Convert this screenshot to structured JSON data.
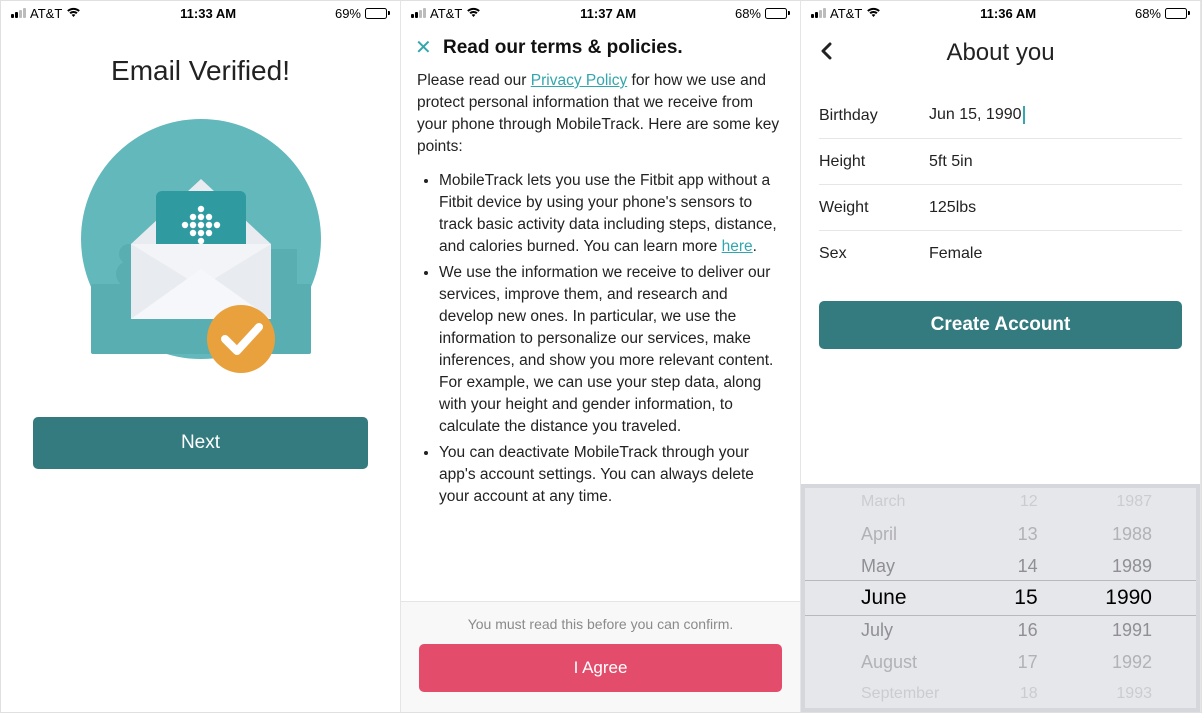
{
  "status": {
    "carrier": "AT&T",
    "screen1": {
      "time": "11:33 AM",
      "battery_pct": "69%",
      "fill": 69
    },
    "screen2": {
      "time": "11:37 AM",
      "battery_pct": "68%",
      "fill": 68
    },
    "screen3": {
      "time": "11:36 AM",
      "battery_pct": "68%",
      "fill": 68
    }
  },
  "screen1": {
    "title": "Email Verified!",
    "next_label": "Next"
  },
  "screen2": {
    "title": "Read our terms & policies.",
    "intro_pre": "Please read our ",
    "privacy_link": "Privacy Policy",
    "intro_post": " for how we use and protect personal information that we receive from your phone through MobileTrack. Here are some key points:",
    "bullet1_pre": "MobileTrack lets you use the Fitbit app without a Fitbit device by using your phone's sensors to track basic activity data including steps, distance, and calories burned. You can learn more ",
    "bullet1_link": "here",
    "bullet1_post": ".",
    "bullet2": "We use the information we receive to deliver our services, improve them, and research and develop new ones. In particular, we use the information to personalize our services, make inferences, and show you more relevant content. For example, we can use your step data, along with your height and gender information, to calculate the distance you traveled.",
    "bullet3": "You can deactivate MobileTrack through your app's account settings. You can always delete your account at any time.",
    "footer_note": "You must read this before you can confirm.",
    "agree_label": "I Agree"
  },
  "screen3": {
    "title": "About you",
    "rows": {
      "birthday_label": "Birthday",
      "birthday_value": "Jun 15, 1990",
      "height_label": "Height",
      "height_value": "5ft 5in",
      "weight_label": "Weight",
      "weight_value": "125lbs",
      "sex_label": "Sex",
      "sex_value": "Female"
    },
    "create_label": "Create Account",
    "picker": {
      "months": [
        "March",
        "April",
        "May",
        "June",
        "July",
        "August",
        "September"
      ],
      "days": [
        "12",
        "13",
        "14",
        "15",
        "16",
        "17",
        "18"
      ],
      "years": [
        "1987",
        "1988",
        "1989",
        "1990",
        "1991",
        "1992",
        "1993"
      ],
      "selected_index": 3
    }
  }
}
